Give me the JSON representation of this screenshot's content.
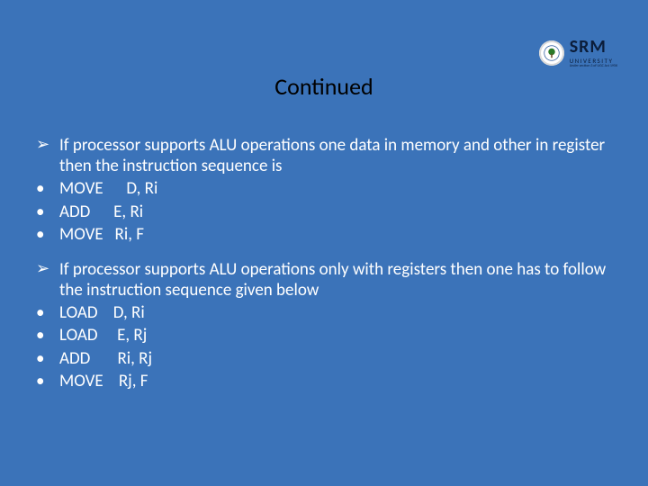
{
  "logo": {
    "name": "SRM",
    "sub": "UNIVERSITY",
    "tag": "Under section 3 of UGC Act 1956"
  },
  "title": "Continued",
  "section1": {
    "lead": "If processor supports ALU operations one data in memory and other in register then the instruction sequence is",
    "lines": [
      "MOVE      D, Ri",
      "ADD      E, Ri",
      "MOVE   Ri, F"
    ]
  },
  "section2": {
    "lead": "If processor supports ALU operations only with registers then one has to follow the instruction sequence given below",
    "lines": [
      "LOAD    D, Ri",
      "LOAD     E, Rj",
      "ADD       Ri, Rj",
      "MOVE    Rj, F"
    ]
  }
}
